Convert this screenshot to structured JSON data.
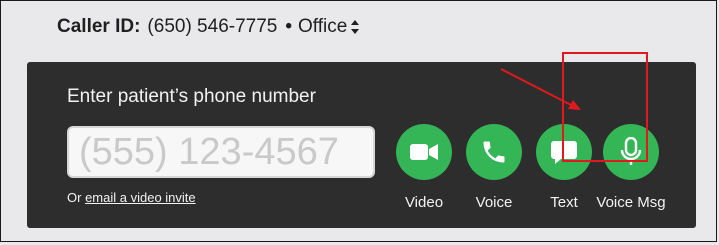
{
  "caller_id": {
    "label": "Caller ID:",
    "number": "(650) 546-7775",
    "separator": "•",
    "location": "Office"
  },
  "panel": {
    "prompt": "Enter patient’s phone number",
    "phone_placeholder": "(555) 123-4567",
    "phone_value": "",
    "alt_prefix": "Or",
    "alt_link": "email a video invite"
  },
  "actions": [
    {
      "label": "Video",
      "icon": "video-camera-icon"
    },
    {
      "label": "Voice",
      "icon": "phone-icon"
    },
    {
      "label": "Text",
      "icon": "chat-bubble-icon"
    },
    {
      "label": "Voice Msg",
      "icon": "microphone-icon"
    }
  ],
  "annotation": {
    "highlight_color": "#e0191e",
    "highlighted_action": "Voice Msg"
  },
  "colors": {
    "panel_bg": "#2d2d2d",
    "button_green": "#34b556",
    "page_bg": "#e9e9eb"
  }
}
